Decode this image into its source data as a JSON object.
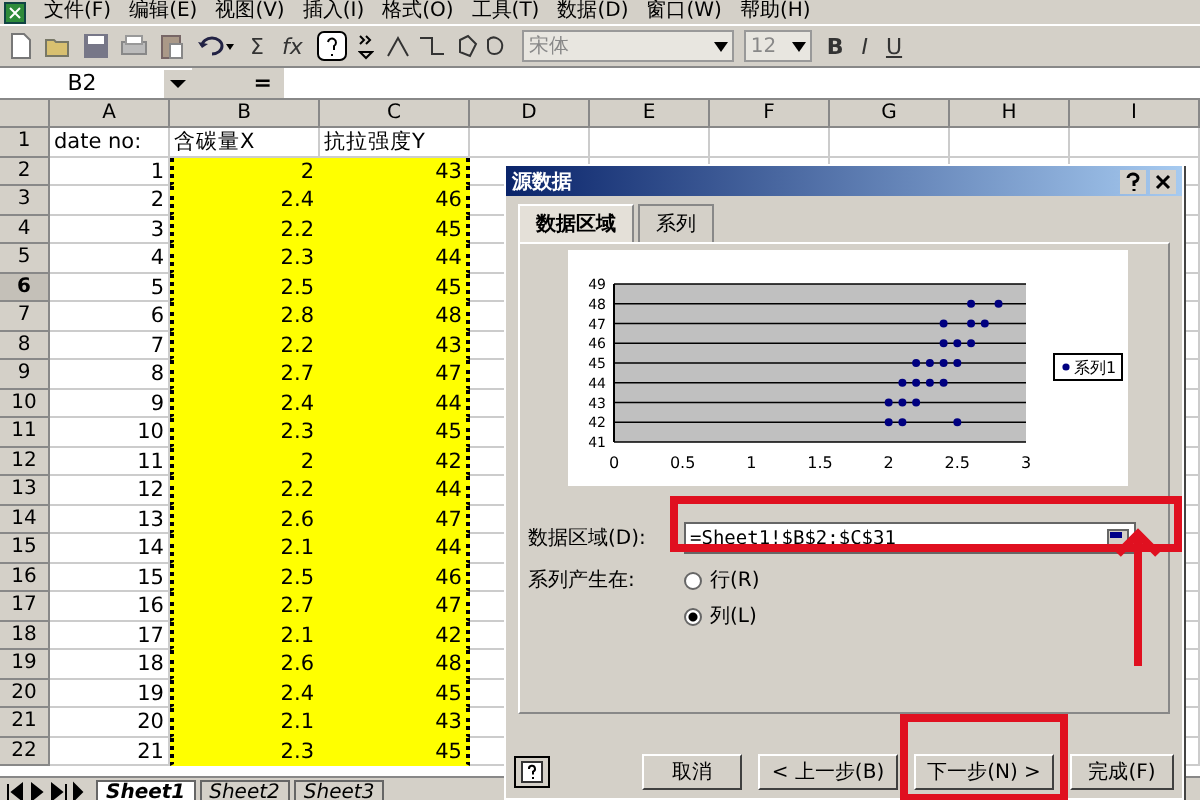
{
  "menu": [
    "文件(F)",
    "编辑(E)",
    "视图(V)",
    "插入(I)",
    "格式(O)",
    "工具(T)",
    "数据(D)",
    "窗口(W)",
    "帮助(H)"
  ],
  "toolbar": {
    "sum": "Σ",
    "function": "fx",
    "font": "宋体",
    "size": "12",
    "bold": "B",
    "italic": "I",
    "underline": "U"
  },
  "name_box": "B2",
  "formula_label": "=",
  "columns": [
    "A",
    "B",
    "C",
    "D",
    "E",
    "F",
    "G",
    "H",
    "I"
  ],
  "rows": [
    {
      "num": "1",
      "selected": false,
      "cells": [
        "date no:",
        "含碳量X",
        "抗拉强度Y"
      ]
    },
    {
      "num": "2",
      "selected": false,
      "cells": [
        "1",
        "2",
        "43"
      ]
    },
    {
      "num": "3",
      "selected": false,
      "cells": [
        "2",
        "2.4",
        "46"
      ]
    },
    {
      "num": "4",
      "selected": false,
      "cells": [
        "3",
        "2.2",
        "45"
      ]
    },
    {
      "num": "5",
      "selected": false,
      "cells": [
        "4",
        "2.3",
        "44"
      ]
    },
    {
      "num": "6",
      "selected": true,
      "cells": [
        "5",
        "2.5",
        "45"
      ]
    },
    {
      "num": "7",
      "selected": false,
      "cells": [
        "6",
        "2.8",
        "48"
      ]
    },
    {
      "num": "8",
      "selected": false,
      "cells": [
        "7",
        "2.2",
        "43"
      ]
    },
    {
      "num": "9",
      "selected": false,
      "cells": [
        "8",
        "2.7",
        "47"
      ]
    },
    {
      "num": "10",
      "selected": false,
      "cells": [
        "9",
        "2.4",
        "44"
      ]
    },
    {
      "num": "11",
      "selected": false,
      "cells": [
        "10",
        "2.3",
        "45"
      ]
    },
    {
      "num": "12",
      "selected": false,
      "cells": [
        "11",
        "2",
        "42"
      ]
    },
    {
      "num": "13",
      "selected": false,
      "cells": [
        "12",
        "2.2",
        "44"
      ]
    },
    {
      "num": "14",
      "selected": false,
      "cells": [
        "13",
        "2.6",
        "47"
      ]
    },
    {
      "num": "15",
      "selected": false,
      "cells": [
        "14",
        "2.1",
        "44"
      ]
    },
    {
      "num": "16",
      "selected": false,
      "cells": [
        "15",
        "2.5",
        "46"
      ]
    },
    {
      "num": "17",
      "selected": false,
      "cells": [
        "16",
        "2.7",
        "47"
      ]
    },
    {
      "num": "18",
      "selected": false,
      "cells": [
        "17",
        "2.1",
        "42"
      ]
    },
    {
      "num": "19",
      "selected": false,
      "cells": [
        "18",
        "2.6",
        "48"
      ]
    },
    {
      "num": "20",
      "selected": false,
      "cells": [
        "19",
        "2.4",
        "45"
      ]
    },
    {
      "num": "21",
      "selected": false,
      "cells": [
        "20",
        "2.1",
        "43"
      ]
    },
    {
      "num": "22",
      "selected": false,
      "cells": [
        "21",
        "2.3",
        "45"
      ]
    }
  ],
  "sheet_tabs": [
    {
      "label": "Sheet1",
      "selected": true
    },
    {
      "label": "Sheet2",
      "selected": false
    },
    {
      "label": "Sheet3",
      "selected": false
    }
  ],
  "dialog": {
    "title": "源数据",
    "tabs": [
      {
        "label": "数据区域",
        "selected": true
      },
      {
        "label": "系列",
        "selected": false
      }
    ],
    "chart_data": {
      "type": "scatter",
      "grid": true,
      "x": [
        2,
        2.4,
        2.2,
        2.3,
        2.5,
        2.8,
        2.2,
        2.7,
        2.4,
        2.3,
        2,
        2.2,
        2.6,
        2.1,
        2.5,
        2.1,
        2.6,
        2.4,
        2.1,
        2.5,
        2.6,
        2.4
      ],
      "series": [
        {
          "name": "系列1",
          "color": "#000080",
          "values": [
            43,
            46,
            45,
            44,
            45,
            48,
            43,
            47,
            44,
            45,
            42,
            44,
            47,
            44,
            46,
            42,
            48,
            45,
            43,
            42,
            46,
            47
          ]
        }
      ],
      "xlim": [
        0,
        3
      ],
      "ylim": [
        41,
        49
      ],
      "xticks": [
        0,
        0.5,
        1,
        1.5,
        2,
        2.5,
        3
      ],
      "yticks": [
        41,
        42,
        43,
        44,
        45,
        46,
        47,
        48,
        49
      ]
    },
    "range_label": "数据区域(D):",
    "range_value": "=Sheet1!$B$2:$C$31",
    "series_in_label": "系列产生在:",
    "options": [
      {
        "label": "行(R)",
        "selected": false
      },
      {
        "label": "列(L)",
        "selected": true
      }
    ],
    "buttons": [
      "取消",
      "< 上一步(B)",
      "下一步(N) >",
      "完成(F)"
    ]
  }
}
